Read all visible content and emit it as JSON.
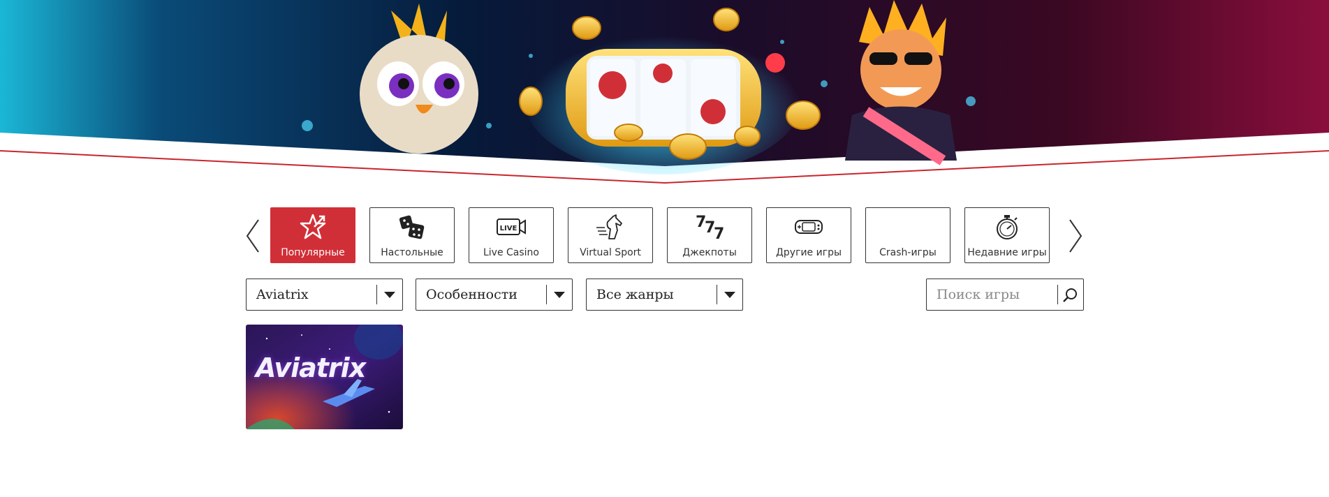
{
  "categories": {
    "prev_icon": "chevron-left-icon",
    "next_icon": "chevron-right-icon",
    "items": [
      {
        "label": "Популярные",
        "icon": "star-trophy-icon",
        "active": true
      },
      {
        "label": "Настольные",
        "icon": "dice-icon",
        "active": false
      },
      {
        "label": "Live Casino",
        "icon": "live-camera-icon",
        "active": false
      },
      {
        "label": "Virtual Sport",
        "icon": "horse-icon",
        "active": false
      },
      {
        "label": "Джекпоты",
        "icon": "777-icon",
        "active": false
      },
      {
        "label": "Другие игры",
        "icon": "gamepad-icon",
        "active": false
      },
      {
        "label": "Crash-игры",
        "icon": "",
        "active": false
      },
      {
        "label": "Недавние игры",
        "icon": "stopwatch-icon",
        "active": false
      }
    ]
  },
  "filters": {
    "provider": "Aviatrix",
    "features": "Особенности",
    "genres": "Все жанры"
  },
  "search": {
    "placeholder": "Поиск игры",
    "value": "",
    "icon": "search-icon"
  },
  "games": [
    {
      "title": "Aviatrix"
    }
  ],
  "colors": {
    "accent": "#d12f37",
    "border": "#333333"
  }
}
